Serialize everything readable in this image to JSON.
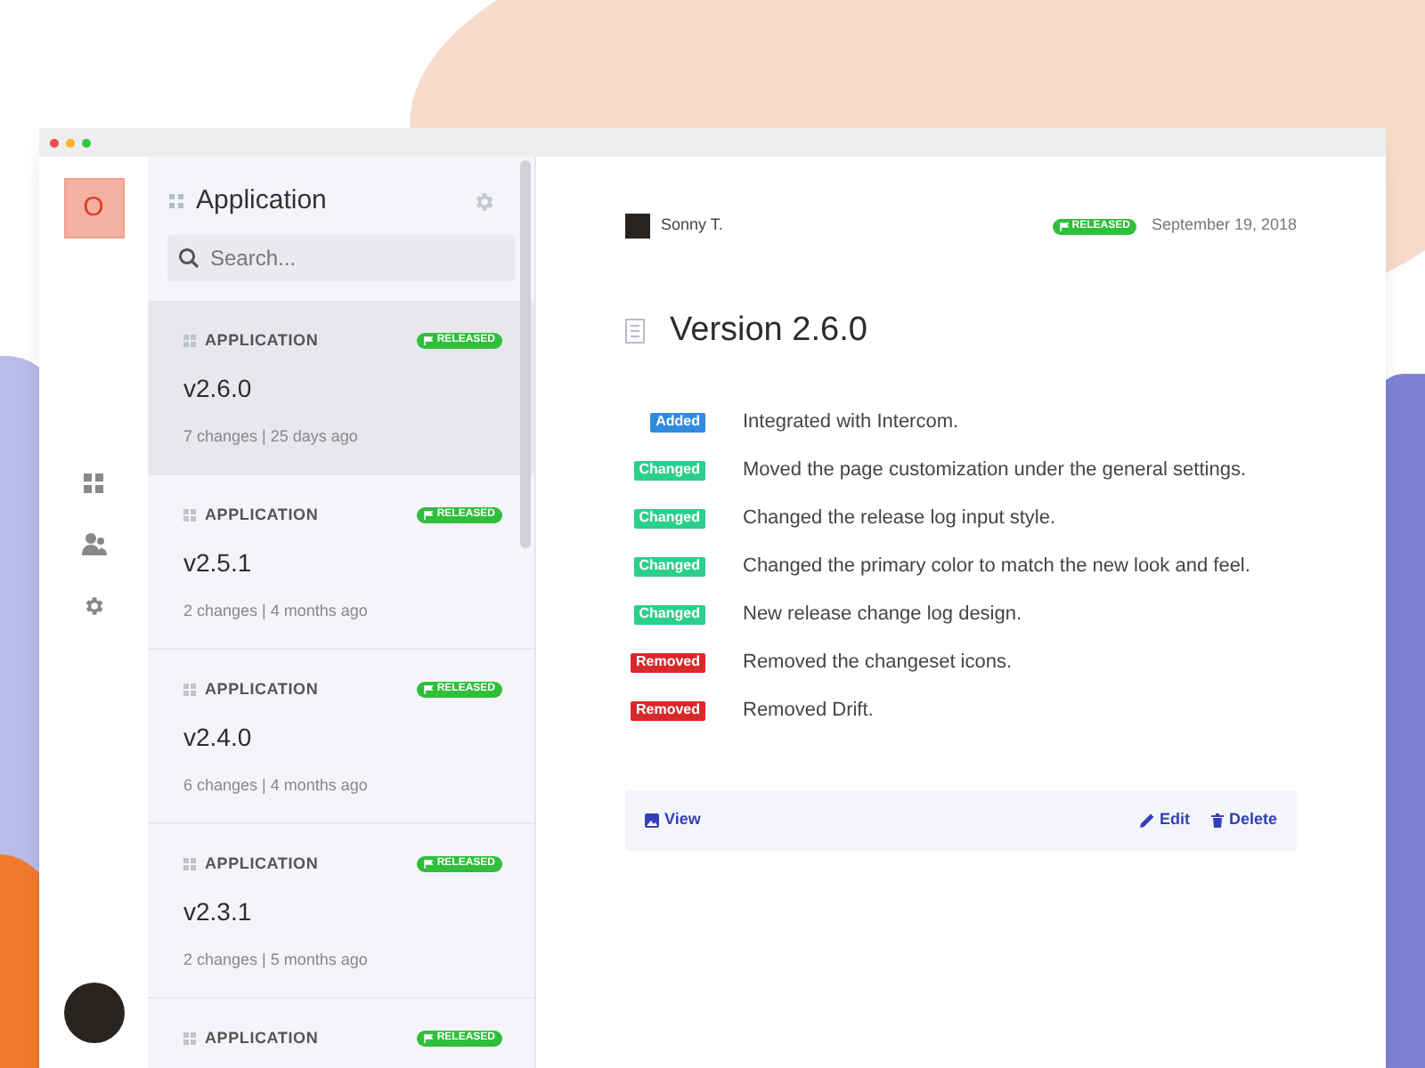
{
  "logo": {
    "letter": "O"
  },
  "nav": [
    {
      "kind": "grid"
    },
    {
      "kind": "users"
    },
    {
      "kind": "settings"
    }
  ],
  "list": {
    "title": "Application",
    "search": {
      "placeholder": "Search..."
    },
    "releases": [
      {
        "category": "APPLICATION",
        "status": "RELEASED",
        "version": "v2.6.0",
        "meta": "7 changes | 25 days ago",
        "selected": true
      },
      {
        "category": "APPLICATION",
        "status": "RELEASED",
        "version": "v2.5.1",
        "meta": "2 changes | 4 months ago",
        "selected": false
      },
      {
        "category": "APPLICATION",
        "status": "RELEASED",
        "version": "v2.4.0",
        "meta": "6 changes | 4 months ago",
        "selected": false
      },
      {
        "category": "APPLICATION",
        "status": "RELEASED",
        "version": "v2.3.1",
        "meta": "2 changes | 5 months ago",
        "selected": false
      },
      {
        "category": "APPLICATION",
        "status": "RELEASED",
        "selected": false
      }
    ]
  },
  "detail": {
    "author": "Sonny T.",
    "status": "RELEASED",
    "date": "September 19, 2018",
    "title": "Version 2.6.0",
    "changes": [
      {
        "kind": "added",
        "label": "Added",
        "text": "Integrated with Intercom."
      },
      {
        "kind": "changed",
        "label": "Changed",
        "text": "Moved the page customization under the general settings."
      },
      {
        "kind": "changed",
        "label": "Changed",
        "text": "Changed the release log input style."
      },
      {
        "kind": "changed",
        "label": "Changed",
        "text": "Changed the primary color to match the new look and feel."
      },
      {
        "kind": "changed",
        "label": "Changed",
        "text": "New release change log design."
      },
      {
        "kind": "removed",
        "label": "Removed",
        "text": "Removed the changeset icons."
      },
      {
        "kind": "removed",
        "label": "Removed",
        "text": "Removed Drift."
      }
    ],
    "actions": [
      {
        "kind": "view",
        "label": "View"
      },
      {
        "kind": "edit",
        "label": "Edit"
      },
      {
        "kind": "delete",
        "label": "Delete"
      }
    ]
  }
}
